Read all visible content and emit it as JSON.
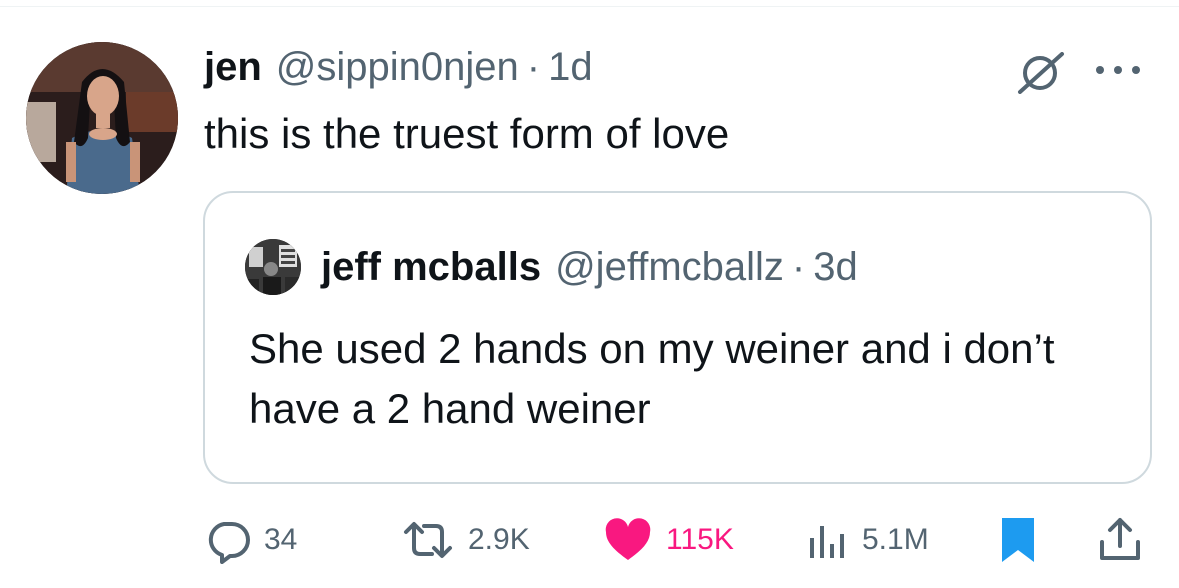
{
  "tweet": {
    "author_name": "jen",
    "author_handle": "@sippin0njen",
    "separator": "·",
    "time": "1d",
    "text": "this is the truest form of love"
  },
  "quoted_tweet": {
    "author_name": "jeff mcballs",
    "author_handle": "@jeffmcballz",
    "separator": "·",
    "time": "3d",
    "text": "She used 2 hands on my weiner and i don’t have a 2 hand weiner"
  },
  "actions": {
    "replies": "34",
    "reposts": "2.9K",
    "likes": "115K",
    "views": "5.1M"
  },
  "icons": {
    "grok": "grok-icon",
    "more": "more-icon",
    "reply": "reply-icon",
    "repost": "repost-icon",
    "like": "heart-icon",
    "views": "views-icon",
    "bookmark": "bookmark-icon",
    "share": "share-icon"
  },
  "colors": {
    "text_primary": "#0f1419",
    "text_secondary": "#536471",
    "like_active": "#f91880",
    "bookmark_active": "#1d9bf0",
    "border": "#cfd9de"
  }
}
